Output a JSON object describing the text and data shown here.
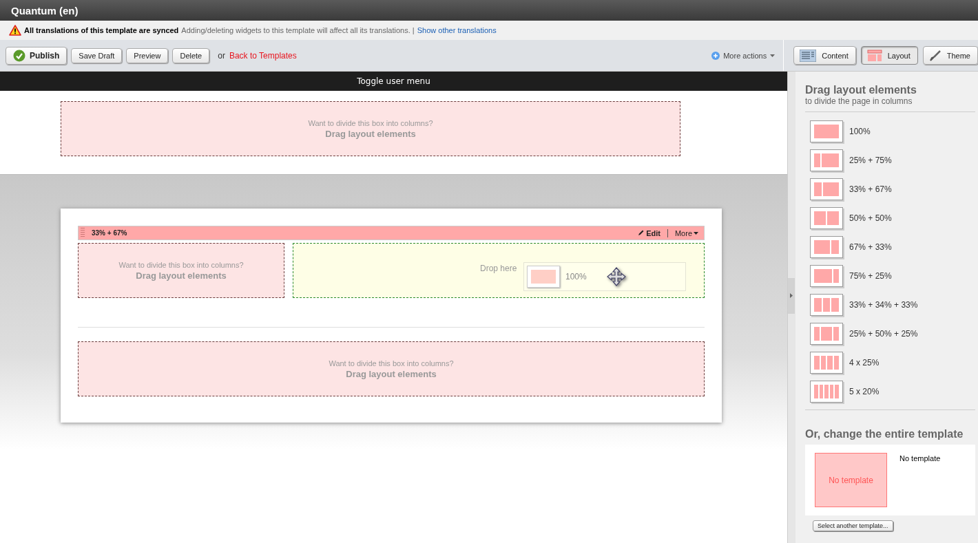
{
  "window": {
    "title": "Quantum (en)"
  },
  "notice": {
    "heading": "All translations of this template are synced",
    "text": "Adding/deleting widgets to this template will affect all its translations. |",
    "link": "Show other translations"
  },
  "toolbar": {
    "buttons": [
      {
        "label": "Publish",
        "kind": "primary"
      },
      {
        "label": "Save Draft",
        "kind": "plain"
      },
      {
        "label": "Preview",
        "kind": "plain"
      },
      {
        "label": "Delete",
        "kind": "plain"
      }
    ],
    "or": "or",
    "back_link": "Back to Templates",
    "more_actions": "More actions"
  },
  "side_tabs": [
    {
      "label": "Content",
      "kind": "content",
      "selected": false
    },
    {
      "label": "Layout",
      "kind": "layout",
      "selected": true
    },
    {
      "label": "Theme",
      "kind": "theme",
      "selected": false
    }
  ],
  "user_menu": "Toggle user menu",
  "header_zone": {
    "hint": "Want to divide this box into columns?",
    "action": "Drag layout elements"
  },
  "row": {
    "title": "33% + 67%",
    "edit": "Edit",
    "more": "More",
    "left_zone": {
      "hint": "Want to divide this box into columns?",
      "action": "Drag layout elements"
    },
    "drop_zone": {
      "hint": "Drop here"
    },
    "dragged_item": {
      "label": "100%"
    }
  },
  "bottom_zone": {
    "hint": "Want to divide this box into columns?",
    "action": "Drag layout elements"
  },
  "panel": {
    "title": "Drag layout elements",
    "subtitle": "to divide the page in columns",
    "layouts": [
      {
        "label": "100%",
        "kind": "one"
      },
      {
        "label": "25% + 75%",
        "kind": "quarter-left"
      },
      {
        "label": "33% + 67%",
        "kind": "third-left"
      },
      {
        "label": "50% + 50%",
        "kind": "halves"
      },
      {
        "label": "67% + 33%",
        "kind": "third-right"
      },
      {
        "label": "75% + 25%",
        "kind": "quarter-right"
      },
      {
        "label": "33% + 34% + 33%",
        "kind": "thirds"
      },
      {
        "label": "25% + 50% + 25%",
        "kind": "center-wide"
      },
      {
        "label": "4 x 25%",
        "kind": "quarters"
      },
      {
        "label": "5 x 20%",
        "kind": "fifths"
      }
    ],
    "template_title": "Or, change the entire template",
    "template_preview": "No template",
    "template_name": "No template",
    "select_button": "Select another template..."
  }
}
